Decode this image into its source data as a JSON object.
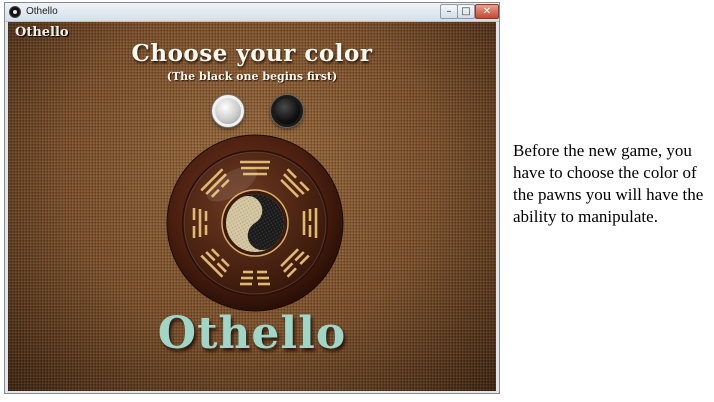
{
  "window": {
    "title": "Othello",
    "icon": "othello-app-icon",
    "controls": {
      "minimize": "–",
      "maximize": "□",
      "close": "✕"
    }
  },
  "game": {
    "corner_logo": "Othello",
    "heading": "Choose your color",
    "subheading": "(The black one begins first)",
    "pawns": [
      {
        "name": "white",
        "color": "#ffffff"
      },
      {
        "name": "black",
        "color": "#000000"
      }
    ],
    "emblem_icon": "bagua-yin-yang-icon",
    "big_logo": "Othello"
  },
  "caption": "Before the new game, you have to choose the color of the pawns you will have the ability to manipulate.",
  "colors": {
    "background_wood": "#7a4f2a",
    "logo_teal": "#9fd6c8",
    "heading_text": "#fbf8f0"
  }
}
